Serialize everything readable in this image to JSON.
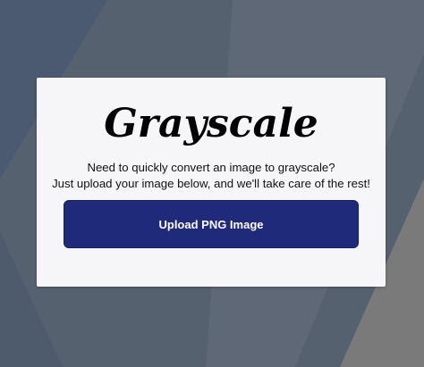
{
  "colors": {
    "background_dark": "#4d5b70",
    "background_mid": "#5b6676",
    "background_gray": "#787878",
    "card": "#f6f6f8",
    "button": "#1f2a7a",
    "button_text": "#ffffff"
  },
  "card": {
    "logo_text": "Grayscale",
    "description_line1": "Need to quickly convert an image to grayscale?",
    "description_line2": "Just upload your image below, and we'll take care of the rest!",
    "upload_button_label": "Upload PNG Image"
  }
}
